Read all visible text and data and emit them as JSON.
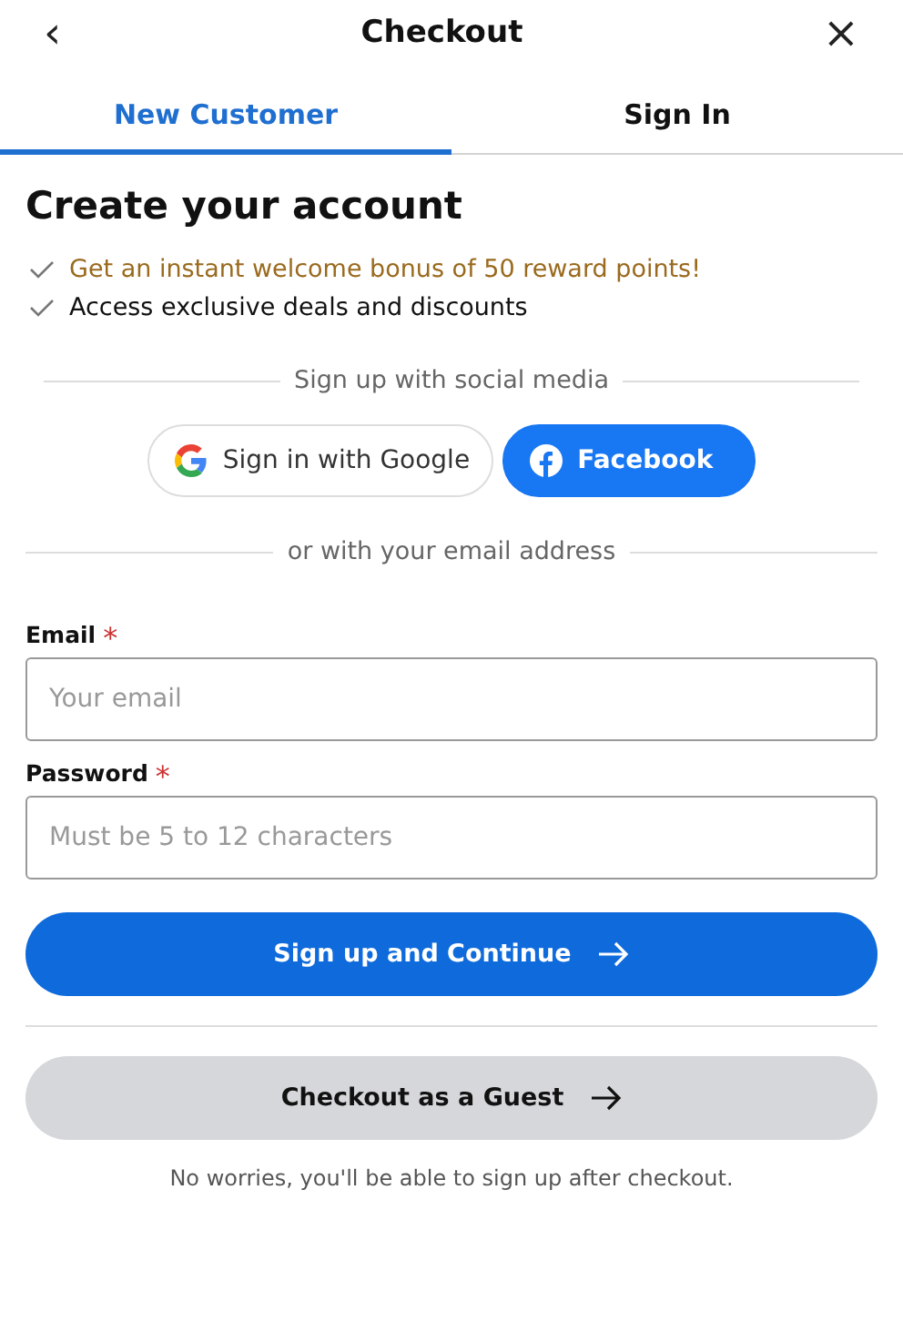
{
  "header": {
    "back": "‹",
    "title": "Checkout",
    "close": "×"
  },
  "tabs": [
    {
      "label": "New Customer",
      "selected": true
    },
    {
      "label": "Sign In",
      "selected": false
    }
  ],
  "heading": "Create your account",
  "benefits": [
    {
      "text": "Get an instant welcome bonus of 50 reward points!",
      "kind": "highlight"
    },
    {
      "text": "Access exclusive deals and discounts",
      "kind": "plain"
    }
  ],
  "social_divider": "Sign up with social media",
  "social_buttons": [
    {
      "label": "Sign in with Google",
      "kind": "google"
    },
    {
      "label": "Facebook",
      "kind": "facebook"
    }
  ],
  "email_divider": "or with your email address",
  "fields": [
    {
      "label": "Email",
      "required_mark": "*",
      "placeholder": "Your email"
    },
    {
      "label": "Password",
      "required_mark": "*",
      "placeholder": "Must be 5 to 12 characters"
    }
  ],
  "primary_button": {
    "label": "Sign up and Continue"
  },
  "guest_button": {
    "label": "Checkout as a Guest"
  },
  "note": "No worries, you'll be able to sign up after checkout."
}
